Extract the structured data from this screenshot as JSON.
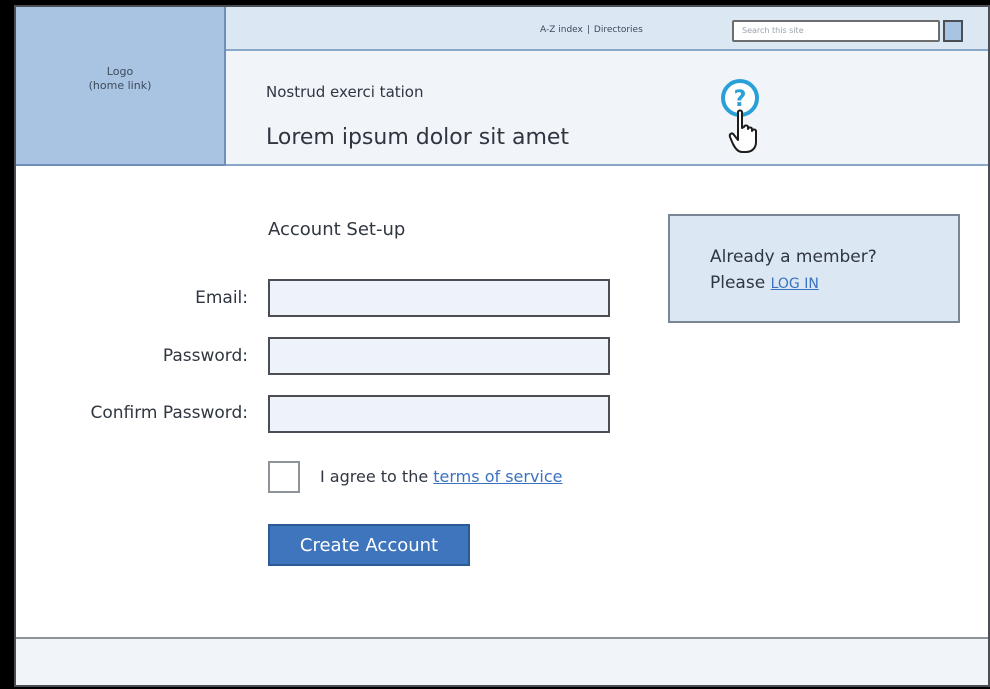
{
  "logo": {
    "line1": "Logo",
    "line2": "(home link)"
  },
  "utility": {
    "az_index": "A-Z index",
    "separator": "|",
    "directories": "Directories",
    "search_placeholder": "Search this site"
  },
  "header": {
    "subtitle": "Nostrud exerci tation",
    "title": "Lorem ipsum dolor sit amet"
  },
  "help_icon": "?",
  "form": {
    "heading": "Account Set-up",
    "email_label": "Email:",
    "email_value": "",
    "password_label": "Password:",
    "password_value": "",
    "confirm_label": "Confirm Password:",
    "confirm_value": "",
    "agree_prefix": "I agree to the",
    "terms_link": "terms of service",
    "agree_checked": false,
    "submit_label": "Create Account"
  },
  "member": {
    "line1": "Already a member?",
    "line2_prefix": "Please",
    "login_link": "LOG IN"
  },
  "icons": [
    "search-button",
    "help-icon",
    "pointer-hand-icon"
  ],
  "colors": {
    "accent": "#3f75bd",
    "logo_bg": "#a9c3e2",
    "panel_bg": "#dce7f4",
    "link": "#3a72c0",
    "help": "#2aa0d8"
  }
}
